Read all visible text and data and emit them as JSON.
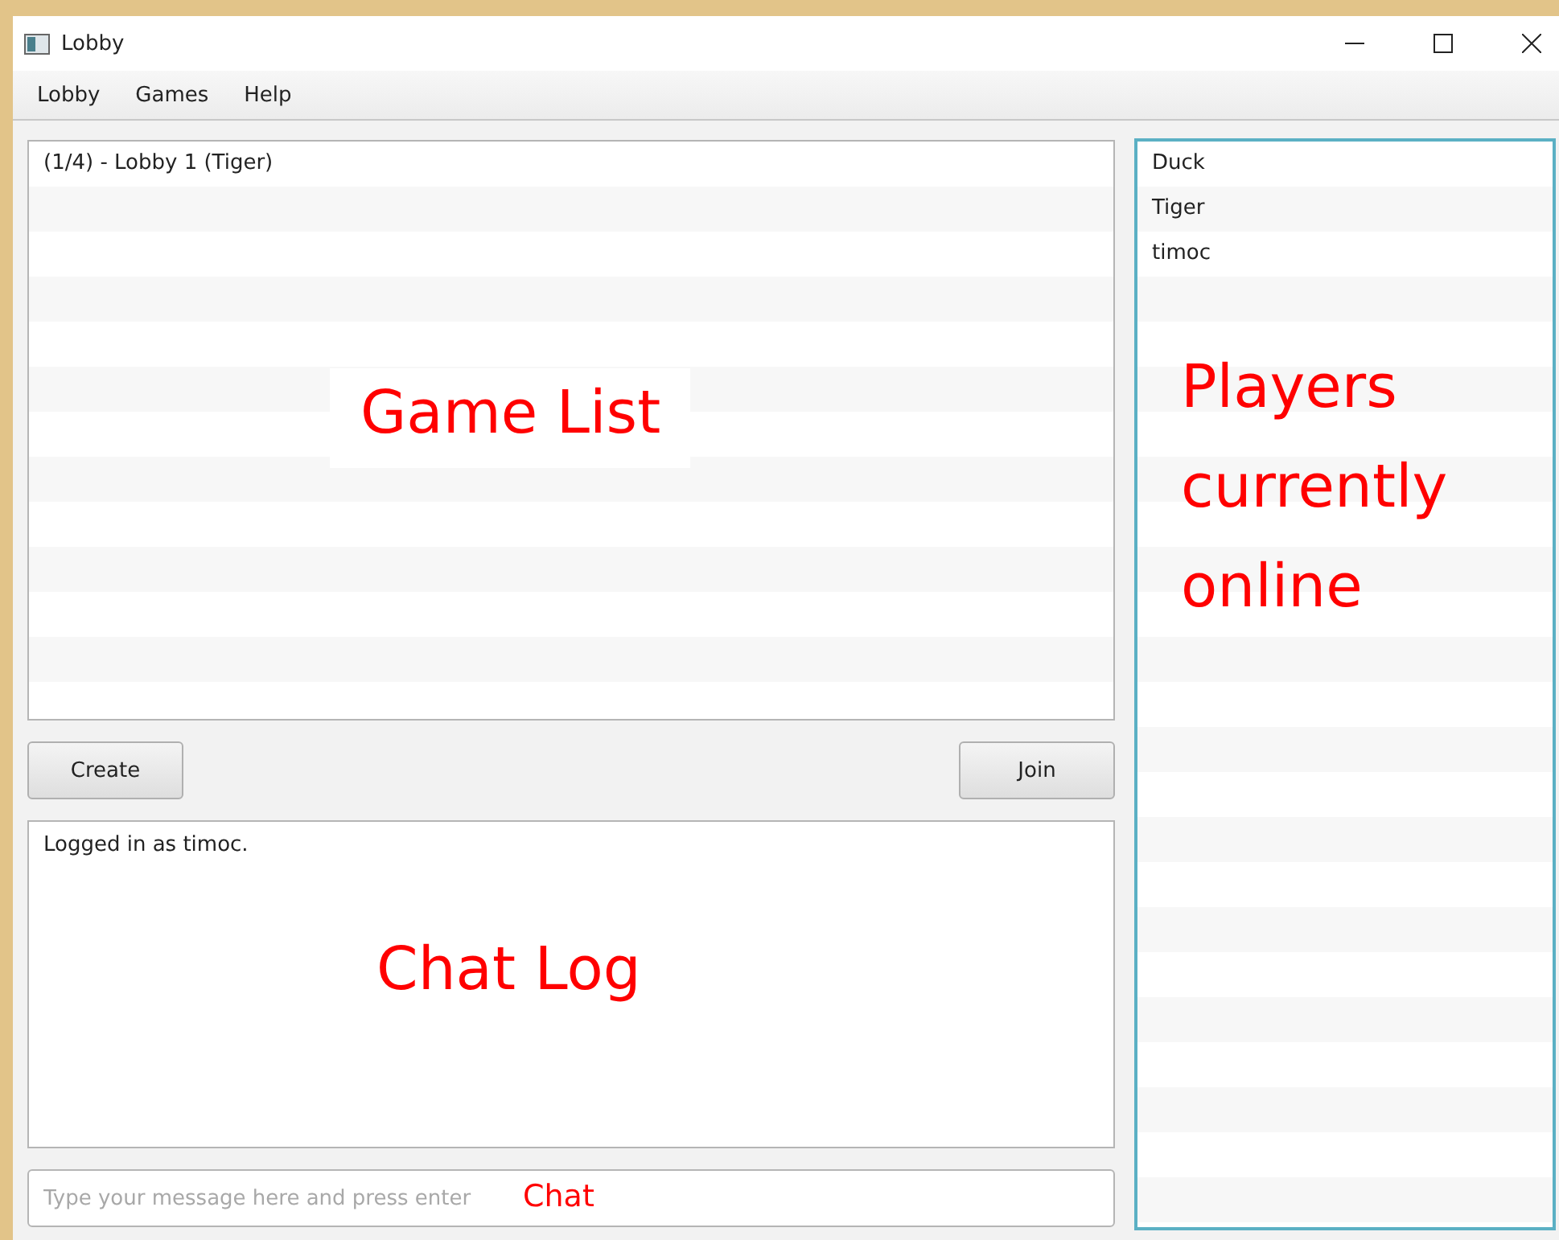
{
  "window": {
    "title": "Lobby"
  },
  "menu": [
    "Lobby",
    "Games",
    "Help"
  ],
  "game_list": {
    "items": [
      "(1/4) - Lobby 1 (Tiger)"
    ],
    "annotation": "Game List"
  },
  "buttons": {
    "create": "Create",
    "join": "Join"
  },
  "chat_log": {
    "lines": [
      "Logged in as timoc."
    ],
    "annotation": "Chat Log"
  },
  "chat_input": {
    "placeholder": "Type your message here and press enter",
    "annotation": "Chat"
  },
  "players": {
    "items": [
      "Duck",
      "Tiger",
      "timoc"
    ],
    "annotation": "Players currently online"
  }
}
